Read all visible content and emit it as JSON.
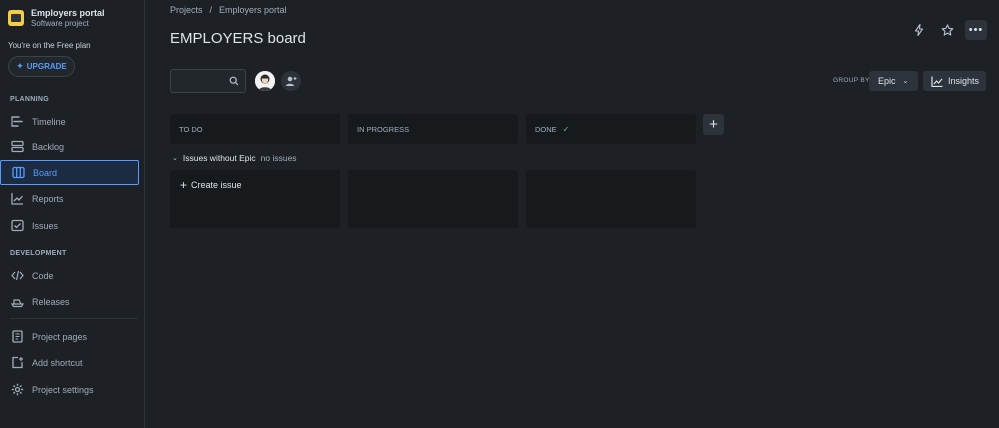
{
  "project": {
    "name": "Employers portal",
    "type": "Software project",
    "plan_text": "You're on the Free plan",
    "upgrade_label": "UPGRADE"
  },
  "sidebar": {
    "planning_title": "PLANNING",
    "development_title": "DEVELOPMENT",
    "planning_items": [
      {
        "label": "Timeline",
        "icon": "timeline-icon"
      },
      {
        "label": "Backlog",
        "icon": "backlog-icon"
      },
      {
        "label": "Board",
        "icon": "board-icon",
        "active": true
      },
      {
        "label": "Reports",
        "icon": "reports-icon"
      },
      {
        "label": "Issues",
        "icon": "issues-icon"
      }
    ],
    "development_items": [
      {
        "label": "Code",
        "icon": "code-icon"
      },
      {
        "label": "Releases",
        "icon": "releases-icon"
      }
    ],
    "bottom_items": [
      {
        "label": "Project pages",
        "icon": "pages-icon"
      },
      {
        "label": "Add shortcut",
        "icon": "add-shortcut-icon"
      },
      {
        "label": "Project settings",
        "icon": "settings-icon"
      }
    ]
  },
  "breadcrumbs": [
    "Projects",
    "/",
    "Employers portal"
  ],
  "page_title": "EMPLOYERS board",
  "toolbar": {
    "search_placeholder": "",
    "group_by_label": "GROUP BY",
    "group_by_value": "Epic",
    "insights_label": "Insights"
  },
  "columns": [
    {
      "name": "TO DO"
    },
    {
      "name": "IN PROGRESS"
    },
    {
      "name": "DONE",
      "done": true
    }
  ],
  "swimlane": {
    "label": "Issues without Epic",
    "count_text": "no issues"
  },
  "create_issue_label": "Create issue",
  "colors": {
    "background": "#1d2125",
    "accent": "#579dff",
    "column": "#161a1d",
    "done_check": "#4bce97",
    "project_avatar": "#f5cd47"
  }
}
